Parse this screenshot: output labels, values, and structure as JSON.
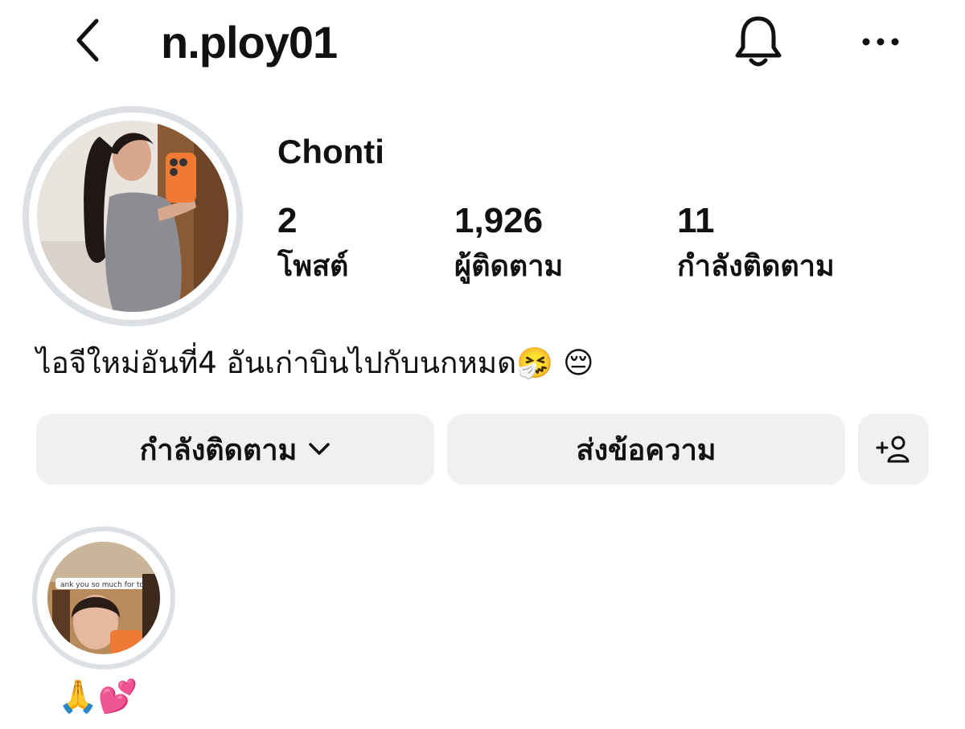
{
  "header": {
    "username": "n.ploy01",
    "icons": {
      "back": "chevron-left-icon",
      "notifications": "bell-icon",
      "more": "more-horizontal-icon"
    }
  },
  "profile": {
    "display_name": "Chonti",
    "stats": [
      {
        "value": "2",
        "label": "โพสต์"
      },
      {
        "value": "1,926",
        "label": "ผู้ติดตาม"
      },
      {
        "value": "11",
        "label": "กำลังติดตาม"
      }
    ],
    "bio": "ไอจีใหม่อันที่4 อันเก่าบินไปกับนกหมด",
    "bio_emoji": "🤧 😔"
  },
  "actions": {
    "following_label": "กำลังติดตาม",
    "message_label": "ส่งข้อความ",
    "add_user_icon": "add-user-icon"
  },
  "highlights": [
    {
      "label": "🙏💕",
      "overlay_text": "ank you so much for today"
    }
  ],
  "colors": {
    "button_bg": "#eff0f2",
    "ring": "#dcdfe4",
    "text": "#111111"
  }
}
